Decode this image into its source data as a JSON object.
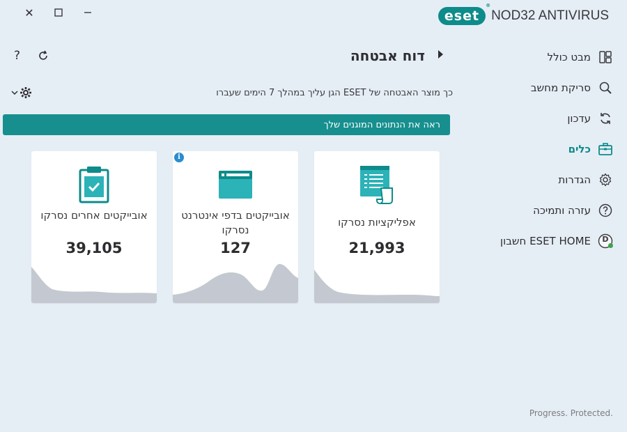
{
  "window": {
    "close_glyph": "✕",
    "maximize_glyph": "☐",
    "minimize_glyph": "—"
  },
  "brand": {
    "logo": "eset",
    "registered": "®",
    "product": "NOD32 ANTIVIRUS"
  },
  "toolbar": {
    "help_glyph": "?"
  },
  "sidebar": {
    "items": [
      {
        "label": "מבט כולל",
        "icon": "dashboard-icon",
        "active": false
      },
      {
        "label": "סריקת מחשב",
        "icon": "search-icon",
        "active": false
      },
      {
        "label": "עדכון",
        "icon": "refresh-icon",
        "active": false
      },
      {
        "label": "כלים",
        "icon": "toolbox-icon",
        "active": true
      },
      {
        "label": "הגדרות",
        "icon": "gear-icon",
        "active": false
      },
      {
        "label": "עזרה ותמיכה",
        "icon": "help-circle-icon",
        "active": false
      },
      {
        "label": "חשבון ESET HOME",
        "icon": "account-avatar-icon",
        "active": false,
        "avatar_letter": "D"
      }
    ]
  },
  "header": {
    "title": "דוח אבטחה",
    "subtitle": "כך מוצר האבטחה של ESET הגן עליך במהלך 7 הימים שעברו",
    "banner": "ראה את הנתונים המוגנים שלך"
  },
  "cards": [
    {
      "label": "אפליקציות נסרקו",
      "value": "21,993",
      "icon": "apps-document-icon"
    },
    {
      "label": "אובייקטים בדפי אינטרנט נסרקו",
      "value": "127",
      "icon": "browser-window-icon",
      "info": "i"
    },
    {
      "label": "אובייקטים אחרים נסרקו",
      "value": "39,105",
      "icon": "clipboard-check-icon"
    }
  ],
  "footer": {
    "tagline": "Progress. Protected."
  },
  "colors": {
    "accent": "#0e8b8b",
    "banner": "#178f8f",
    "background": "#e6eef5",
    "chart_fill": "#c4c9d1",
    "info": "#2b8ccf",
    "online": "#3fa34d"
  }
}
